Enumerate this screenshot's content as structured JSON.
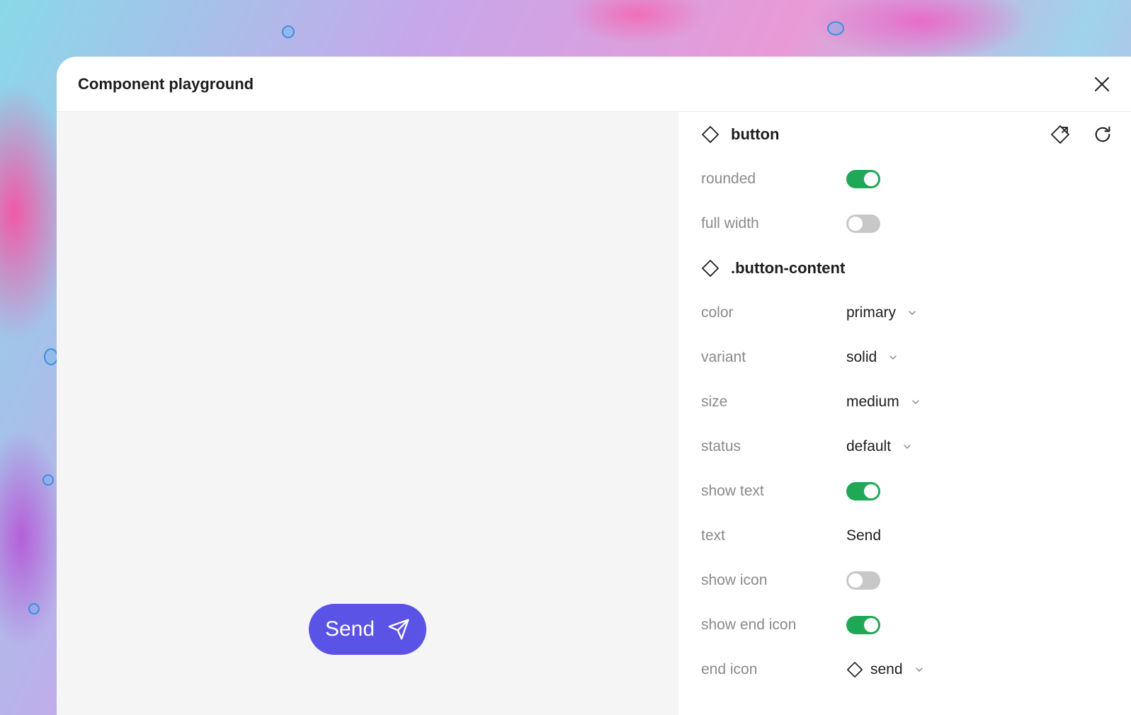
{
  "panel": {
    "title": "Component playground"
  },
  "preview": {
    "button_label": "Send",
    "button_color": "#5b52e6"
  },
  "sections": [
    {
      "name": "button",
      "icon": "diamond-icon",
      "actions": [
        "open-external-icon",
        "reset-icon"
      ],
      "props": [
        {
          "label": "rounded",
          "type": "toggle",
          "value": true
        },
        {
          "label": "full width",
          "type": "toggle",
          "value": false
        }
      ]
    },
    {
      "name": ".button-content",
      "icon": "diamond-icon",
      "props": [
        {
          "label": "color",
          "type": "select",
          "value": "primary"
        },
        {
          "label": "variant",
          "type": "select",
          "value": "solid"
        },
        {
          "label": "size",
          "type": "select",
          "value": "medium"
        },
        {
          "label": "status",
          "type": "select",
          "value": "default"
        },
        {
          "label": "show text",
          "type": "toggle",
          "value": true
        },
        {
          "label": "text",
          "type": "text",
          "value": "Send"
        },
        {
          "label": "show icon",
          "type": "toggle",
          "value": false
        },
        {
          "label": "show end icon",
          "type": "toggle",
          "value": true
        },
        {
          "label": "end icon",
          "type": "select",
          "value": "send",
          "icon": "diamond-icon"
        }
      ]
    }
  ],
  "colors": {
    "toggle_on": "#1fa855",
    "toggle_off": "#c8c8c8",
    "accent": "#5b52e6"
  }
}
